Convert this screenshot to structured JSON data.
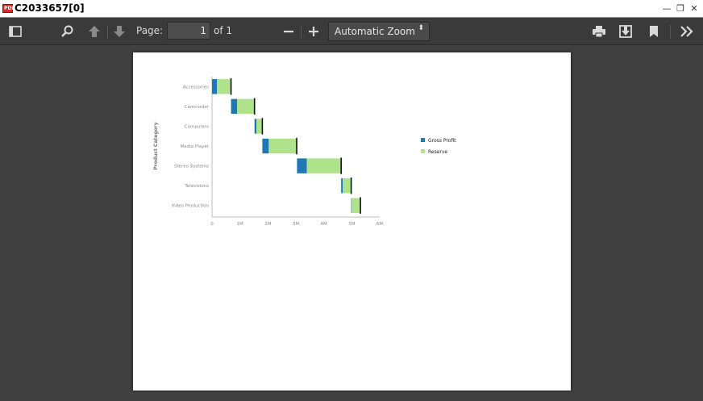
{
  "window": {
    "title": "C2033657[0]",
    "app_icon_text": "PDF",
    "minimize": "—",
    "restore": "❐",
    "close": "✕"
  },
  "toolbar": {
    "page_label": "Page:",
    "page_value": "1",
    "page_of": "of 1",
    "zoom_value": "Automatic Zoom",
    "zoom_arrow": "⬍"
  },
  "icons": [
    "sidebar-toggle-icon",
    "search-icon",
    "previous-page-icon",
    "next-page-icon",
    "zoom-out-icon",
    "zoom-in-icon",
    "print-icon",
    "download-icon",
    "bookmark-icon",
    "tools-icon"
  ],
  "chart_data": {
    "type": "bar",
    "subtype": "waterfall-horizontal",
    "ylabel": "Product Category",
    "xlabel": "",
    "categories": [
      "Accessories",
      "Camcorder",
      "Computers",
      "Media Player",
      "Stereo Systems",
      "Televisions",
      "Video Production"
    ],
    "x_ticks": [
      "0",
      "1M",
      "2M",
      "3M",
      "4M",
      "5M",
      "6M"
    ],
    "xlim": [
      0,
      6000000
    ],
    "series": [
      {
        "name": "Gross Profit",
        "color": "#1f77b4",
        "start": [
          0,
          680000,
          1520000,
          1800000,
          3040000,
          4620000,
          4980000
        ],
        "values": [
          180000,
          220000,
          70000,
          230000,
          350000,
          60000,
          20000
        ]
      },
      {
        "name": "Reserve",
        "color": "#aee38b",
        "start": [
          180000,
          900000,
          1590000,
          2030000,
          3390000,
          4680000,
          5000000
        ],
        "values": [
          500000,
          620000,
          210000,
          1000000,
          1230000,
          300000,
          310000
        ]
      }
    ],
    "legend": {
      "position": "right",
      "labels": [
        "Gross  Profit",
        "Reserve"
      ]
    },
    "grid": false
  }
}
